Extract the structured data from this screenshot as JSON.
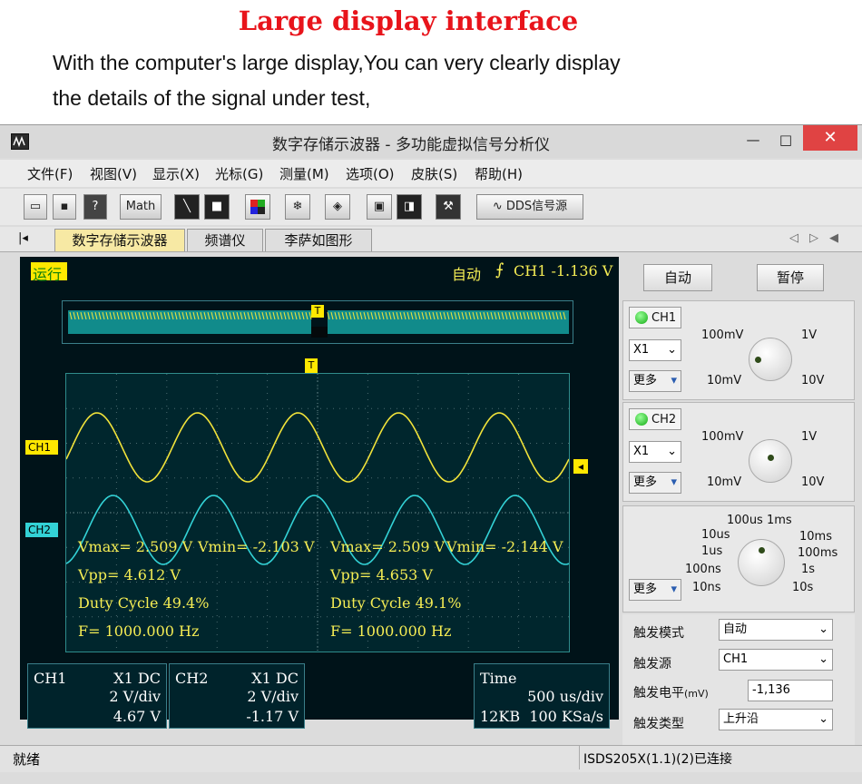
{
  "heading": "Large display interface",
  "intro_line1": "With the computer's large display,You can very clearly display",
  "intro_line2": "the details of the signal under test,",
  "window": {
    "title": "数字存储示波器 - 多功能虚拟信号分析仪",
    "minimize": "—",
    "maximize": "□",
    "close": "✕"
  },
  "menu": [
    "文件(F)",
    "视图(V)",
    "显示(X)",
    "光标(G)",
    "测量(M)",
    "选项(O)",
    "皮肤(S)",
    "帮助(H)"
  ],
  "toolbar": {
    "math": "Math",
    "dds": "DDS信号源"
  },
  "tabs": [
    "数字存储示波器",
    "频谱仪",
    "李萨如图形"
  ],
  "tab_nav": [
    "◁",
    "▷",
    "◀"
  ],
  "scope": {
    "run_status": "运行",
    "trigger_mode": "自动",
    "trigger_info": "CH1 -1.136 V",
    "trigger_marker": "T",
    "ch1_marker": "CH1",
    "ch2_marker": "CH2",
    "level_marker": "◂",
    "ch1_meas": {
      "vmax": "Vmax= 2.509 V",
      "vmin": "Vmin= -2.103 V",
      "vpp": "Vpp= 4.612 V",
      "duty": "Duty Cycle 49.4%",
      "freq": "F= 1000.000 Hz"
    },
    "ch2_meas": {
      "vmax": "Vmax= 2.509 V",
      "vmin": "Vmin= -2.144 V",
      "vpp": "Vpp= 4.653 V",
      "duty": "Duty Cycle 49.1%",
      "freq": "F= 1000.000 Hz"
    },
    "ch1_box": {
      "name": "CH1",
      "mode": "X1  DC",
      "vdiv": "2 V/div",
      "offset": "4.67 V"
    },
    "ch2_box": {
      "name": "CH2",
      "mode": "X1  DC",
      "vdiv": "2 V/div",
      "offset": "-1.17 V"
    },
    "time_box": {
      "label": "Time",
      "tdiv": "500 us/div",
      "mem": "12KB",
      "rate": "100 KSa/s"
    }
  },
  "panel": {
    "auto_button": "自动",
    "pause_button": "暂停",
    "ch1_label": "CH1",
    "ch2_label": "CH2",
    "probe": "X1",
    "more": "更多",
    "volt_labels": {
      "l1": "100mV",
      "r1": "1V",
      "l2": "10mV",
      "r2": "10V"
    },
    "time_labels": {
      "top": "100us  1ms",
      "l1": "10us",
      "r1": "10ms",
      "l2": "1us",
      "r2": "100ms",
      "l3": "100ns",
      "r3": "1s",
      "l4": "10ns",
      "r4": "10s"
    },
    "trig_mode_label": "触发模式",
    "trig_mode": "自动",
    "trig_source_label": "触发源",
    "trig_source": "CH1",
    "trig_level_label": "触发电平",
    "trig_level_unit": "(mV)",
    "trig_level": "-1,136",
    "trig_type_label": "触发类型",
    "trig_type": "上升沿"
  },
  "status": {
    "left": "就绪",
    "right": "ISDS205X(1.1)(2)已连接"
  },
  "colors": {
    "ch1": "#f1e33a",
    "ch2": "#33d2d6",
    "heading": "#e8141b"
  }
}
